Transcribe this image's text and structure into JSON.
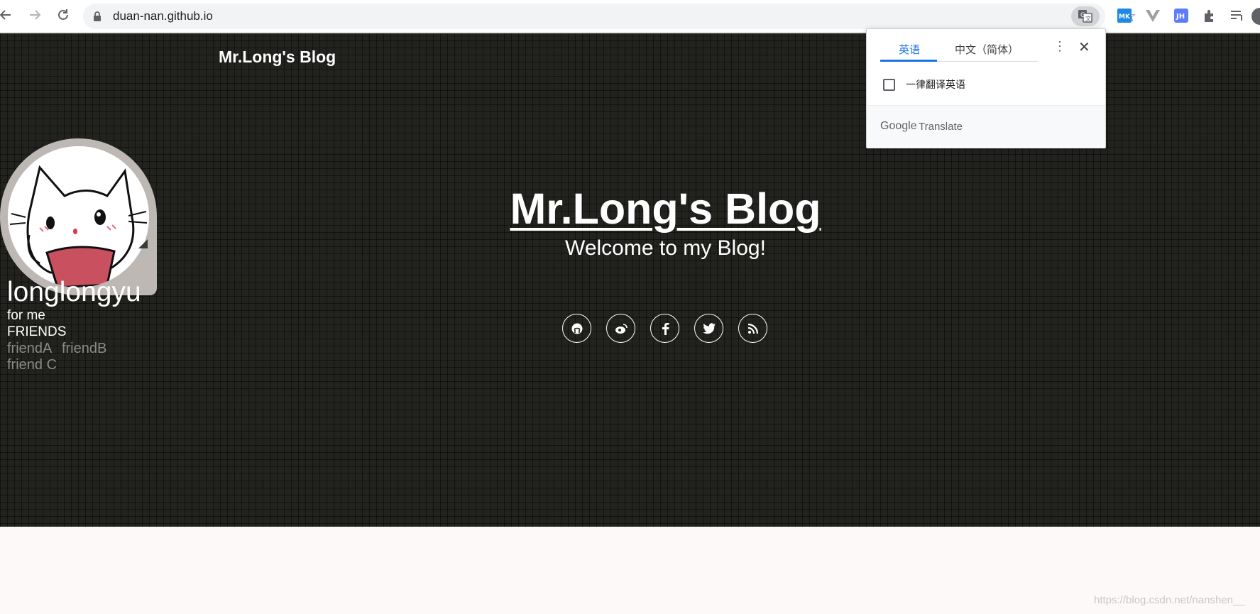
{
  "browser": {
    "url": "duan-nan.github.io",
    "extensions": [
      "mk-extension-icon",
      "vue-devtools-icon",
      "jh-extension-icon",
      "puzzle-icon",
      "reading-list-icon"
    ]
  },
  "site": {
    "brand": "Mr.Long's Blog",
    "nav_partial": "s",
    "title": "Mr.Long's Blog",
    "subtitle": "Welcome to my Blog!",
    "social_icons": [
      "github-icon",
      "weibo-icon",
      "facebook-icon",
      "twitter-icon",
      "rss-icon"
    ]
  },
  "profile": {
    "username": "longlongyu",
    "tagline": "for me",
    "friends_heading": "FRIENDS",
    "friends": [
      "friendA",
      "friendB",
      "friend C"
    ]
  },
  "translate_popup": {
    "tab_source": "英语",
    "tab_target": "中文（简体）",
    "checkbox_label": "一律翻译英语",
    "checkbox_checked": false,
    "brand_google": "Google",
    "brand_translate": "Translate"
  },
  "watermark": "https://blog.csdn.net/nanshen__",
  "colors": {
    "hero_bg": "#22231f",
    "accent_blue": "#1a73e8",
    "bottom_bg": "#fdf9f8"
  }
}
